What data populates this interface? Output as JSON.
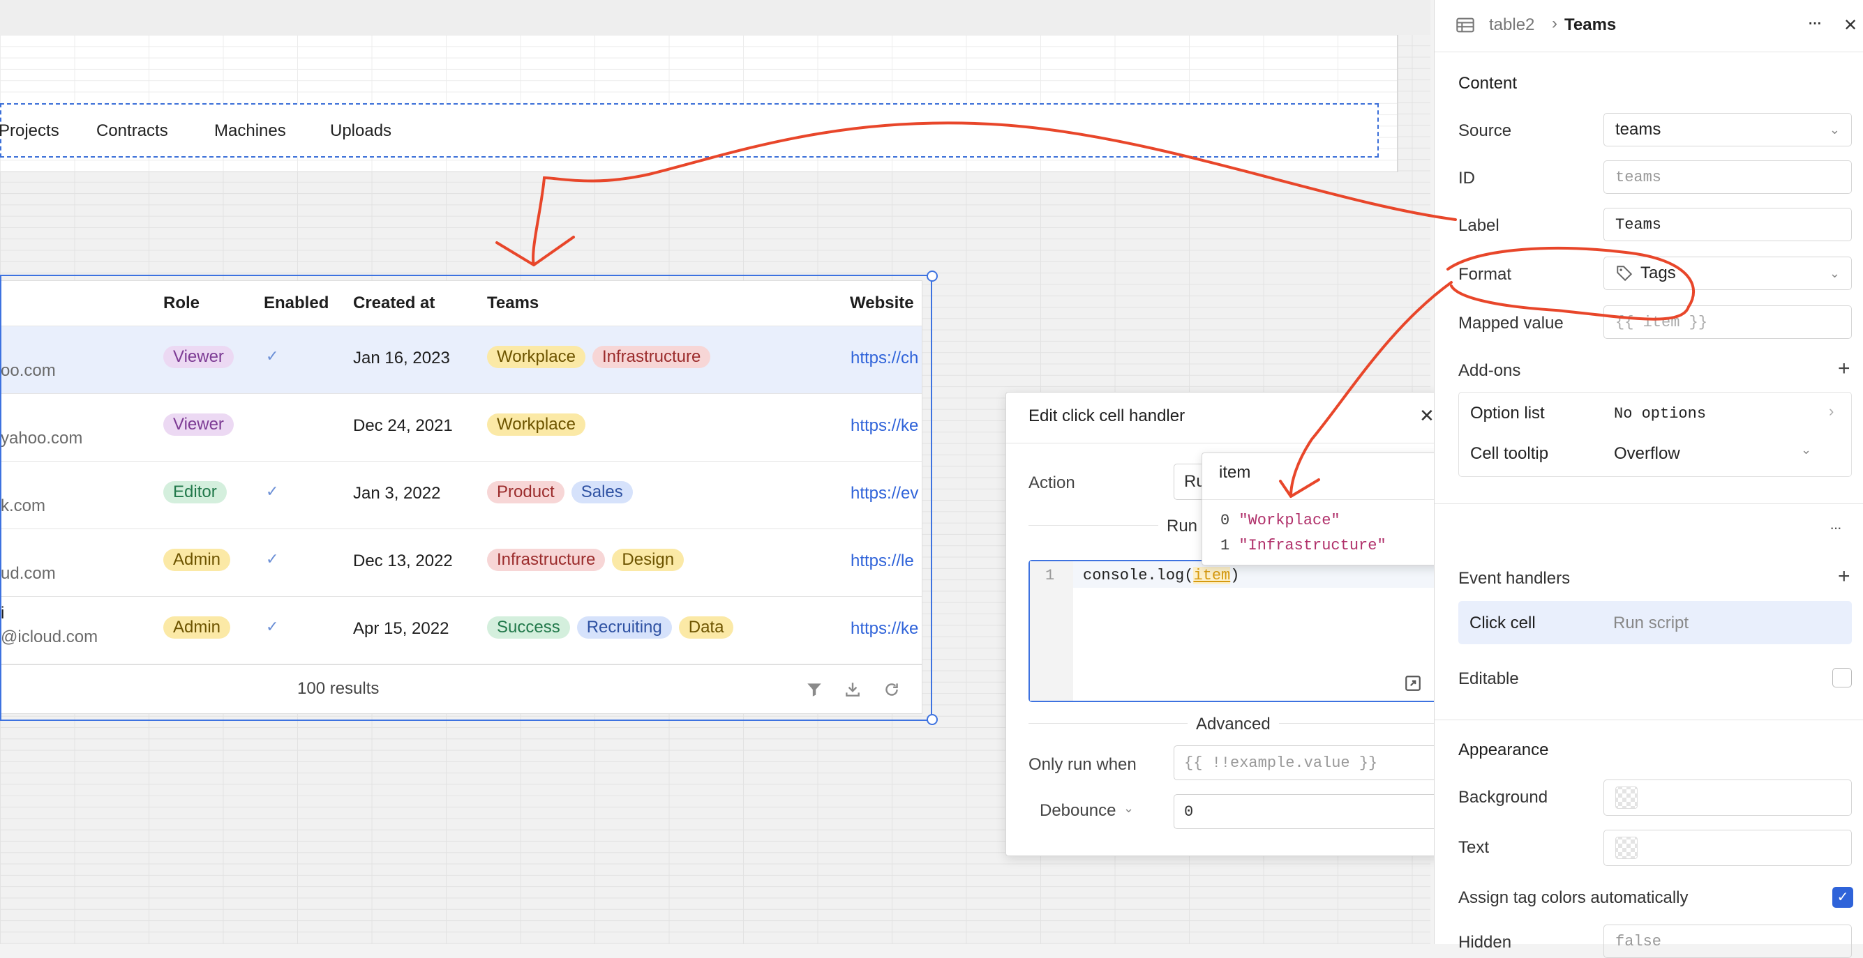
{
  "nav": {
    "items": [
      "Projects",
      "Contracts",
      "Machines",
      "Uploads"
    ]
  },
  "table": {
    "columns": [
      "Role",
      "Enabled",
      "Created at",
      "Teams",
      "Website"
    ],
    "rows": [
      {
        "email": "oo.com",
        "name": "",
        "role": "Viewer",
        "enabled": true,
        "created": "Jan 16, 2023",
        "teams": [
          "Workplace",
          "Infrastructure"
        ],
        "website": "https://ch"
      },
      {
        "email": "yahoo.com",
        "name": "",
        "role": "Viewer",
        "enabled": false,
        "created": "Dec 24, 2021",
        "teams": [
          "Workplace"
        ],
        "website": "https://ke"
      },
      {
        "email": "k.com",
        "name": "",
        "role": "Editor",
        "enabled": true,
        "created": "Jan 3, 2022",
        "teams": [
          "Product",
          "Sales"
        ],
        "website": "https://ev"
      },
      {
        "email": "ud.com",
        "name": "",
        "role": "Admin",
        "enabled": true,
        "created": "Dec 13, 2022",
        "teams": [
          "Infrastructure",
          "Design"
        ],
        "website": "https://le"
      },
      {
        "email": "@icloud.com",
        "name": "i",
        "role": "Admin",
        "enabled": true,
        "created": "Apr 15, 2022",
        "teams": [
          "Success",
          "Recruiting",
          "Data"
        ],
        "website": "https://ke"
      }
    ],
    "footer": "100 results",
    "check_glyph": "✓"
  },
  "modal": {
    "title": "Edit click cell handler",
    "action_label": "Action",
    "action_value": "Ru",
    "run_label": "Run s",
    "code_line_no": "1",
    "code_prefix": "console.log(",
    "code_var": "item",
    "code_suffix": ")",
    "advanced_label": "Advanced",
    "only_run_label": "Only run when",
    "only_run_placeholder": "{{ !!example.value }}",
    "debounce_label": "Debounce",
    "debounce_value": "0"
  },
  "popover": {
    "title": "item",
    "entries": [
      {
        "index": "0",
        "value": "\"Workplace\""
      },
      {
        "index": "1",
        "value": "\"Infrastructure\""
      }
    ]
  },
  "panel": {
    "breadcrumb_parent": "table2",
    "breadcrumb_current": "Teams",
    "more_glyph": "···",
    "close_glyph": "✕",
    "content_title": "Content",
    "source_label": "Source",
    "source_value": "teams",
    "id_label": "ID",
    "id_placeholder": "teams",
    "label_label": "Label",
    "label_value": "Teams",
    "format_label": "Format",
    "format_value": "Tags",
    "mapped_label": "Mapped value",
    "mapped_placeholder": "{{ item }}",
    "addons_label": "Add-ons",
    "option_list_label": "Option list",
    "option_list_value": "No options",
    "cell_tooltip_label": "Cell tooltip",
    "cell_tooltip_value": "Overflow",
    "event_handlers_label": "Event handlers",
    "handler_event": "Click cell",
    "handler_action": "Run script",
    "editable_label": "Editable",
    "appearance_title": "Appearance",
    "background_label": "Background",
    "text_label": "Text",
    "auto_colors_label": "Assign tag colors automatically",
    "hidden_label": "Hidden",
    "hidden_value": "false"
  },
  "colors": {
    "accent": "#3d72e0",
    "annotation": "#e8462a",
    "viewer_bg": "#ecd9f3",
    "viewer_fg": "#7d3b94",
    "editor_bg": "#d4efdd",
    "editor_fg": "#21784a",
    "admin_bg": "#fbe9a6",
    "admin_fg": "#6d5400"
  }
}
